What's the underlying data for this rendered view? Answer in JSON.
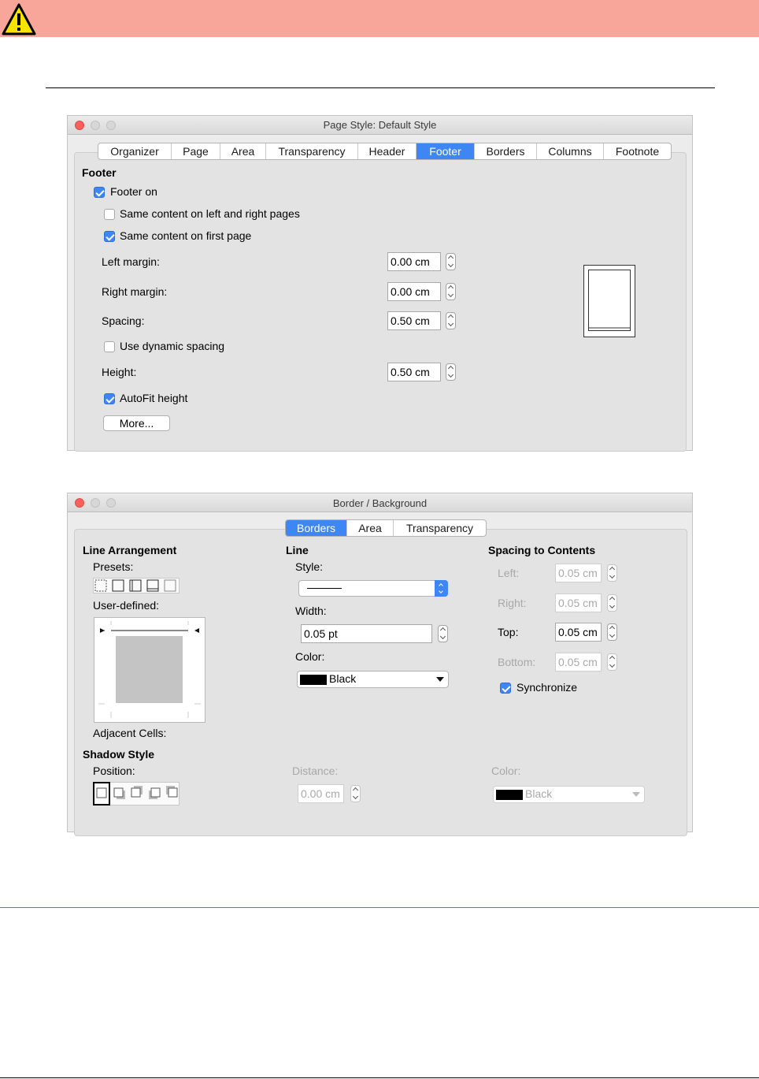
{
  "warning": {
    "icon": "warning-triangle-icon",
    "color": "#f8a59a"
  },
  "page_style_dialog": {
    "title": "Page Style: Default Style",
    "tabs": [
      "Organizer",
      "Page",
      "Area",
      "Transparency",
      "Header",
      "Footer",
      "Borders",
      "Columns",
      "Footnote"
    ],
    "active_tab": "Footer",
    "section_heading": "Footer",
    "footer_on": {
      "label": "Footer on",
      "checked": true
    },
    "same_left_right": {
      "label": "Same content on left and right pages",
      "checked": false
    },
    "same_first": {
      "label": "Same content on first page",
      "checked": true
    },
    "left_margin": {
      "label": "Left margin:",
      "value": "0.00 cm"
    },
    "right_margin": {
      "label": "Right margin:",
      "value": "0.00 cm"
    },
    "spacing": {
      "label": "Spacing:",
      "value": "0.50 cm"
    },
    "dynamic_spacing": {
      "label": "Use dynamic spacing",
      "checked": false
    },
    "height": {
      "label": "Height:",
      "value": "0.50 cm"
    },
    "autofit": {
      "label": "AutoFit height",
      "checked": true
    },
    "more_button": "More..."
  },
  "border_dialog": {
    "title": "Border / Background",
    "tabs": [
      "Borders",
      "Area",
      "Transparency"
    ],
    "active_tab": "Borders",
    "line_arrangement": {
      "heading": "Line Arrangement",
      "presets_label": "Presets:",
      "user_defined_label": "User-defined:",
      "adjacent_cells_label": "Adjacent Cells:"
    },
    "line": {
      "heading": "Line",
      "style_label": "Style:",
      "width_label": "Width:",
      "width_value": "0.05 pt",
      "color_label": "Color:",
      "color_value": "Black"
    },
    "spacing": {
      "heading": "Spacing to Contents",
      "left_label": "Left:",
      "left_value": "0.05 cm",
      "right_label": "Right:",
      "right_value": "0.05 cm",
      "top_label": "Top:",
      "top_value": "0.05 cm",
      "bottom_label": "Bottom:",
      "bottom_value": "0.05 cm",
      "synchronize": {
        "label": "Synchronize",
        "checked": true
      }
    },
    "shadow": {
      "heading": "Shadow Style",
      "position_label": "Position:",
      "distance_label": "Distance:",
      "distance_value": "0.00 cm",
      "color_label": "Color:",
      "color_value": "Black"
    }
  },
  "colors": {
    "accent": "#3f86f5",
    "green_rule": "#4a9a3c"
  }
}
